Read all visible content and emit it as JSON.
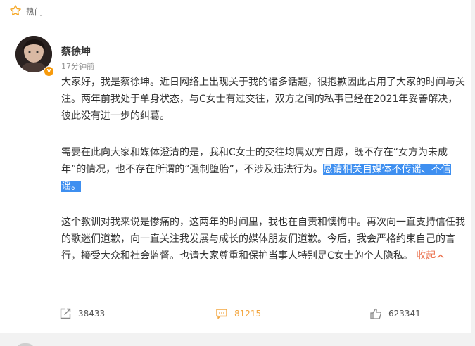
{
  "header": {
    "section_label": "热门",
    "icon": "star-icon"
  },
  "post": {
    "author": "蔡徐坤",
    "time": "17分钟前",
    "verified_badge": "v",
    "colors": {
      "highlight_bg": "#3e8ff0",
      "collapse_link": "#eb7350",
      "comment_count": "#f3a63f",
      "verified": "#f79a0b"
    },
    "paragraph1": "大家好，我是蔡徐坤。近日网络上出现关于我的诸多话题，很抱歉因此占用了大家的时间与关注。两年前我处于单身状态，与C女士有过交往，双方之间的私事已经在2021年妥善解决，彼此没有进一步的纠葛。",
    "paragraph2_plain": "需要在此向大家和媒体澄清的是，我和C女士的交往均属双方自愿，既不存在“女方为未成年”的情况，也不存在所谓的“强制堕胎”，不涉及违法行为。",
    "paragraph2_highlight": "恳请相关自媒体不传谣、不信谣。",
    "paragraph3": "这个教训对我来说是惨痛的，这两年的时间里，我也在自责和懊悔中。再次向一直支持信任我的歌迷们道歉，向一直关注我发展与成长的媒体朋友们道歉。今后，我会严格约束自己的言行，接受大众和社会监督。也请大家尊重和保护当事人特别是C女士的个人隐私。",
    "collapse_label": "收起"
  },
  "actions": {
    "share_count": "38433",
    "comment_count": "81215",
    "like_count": "623341"
  }
}
